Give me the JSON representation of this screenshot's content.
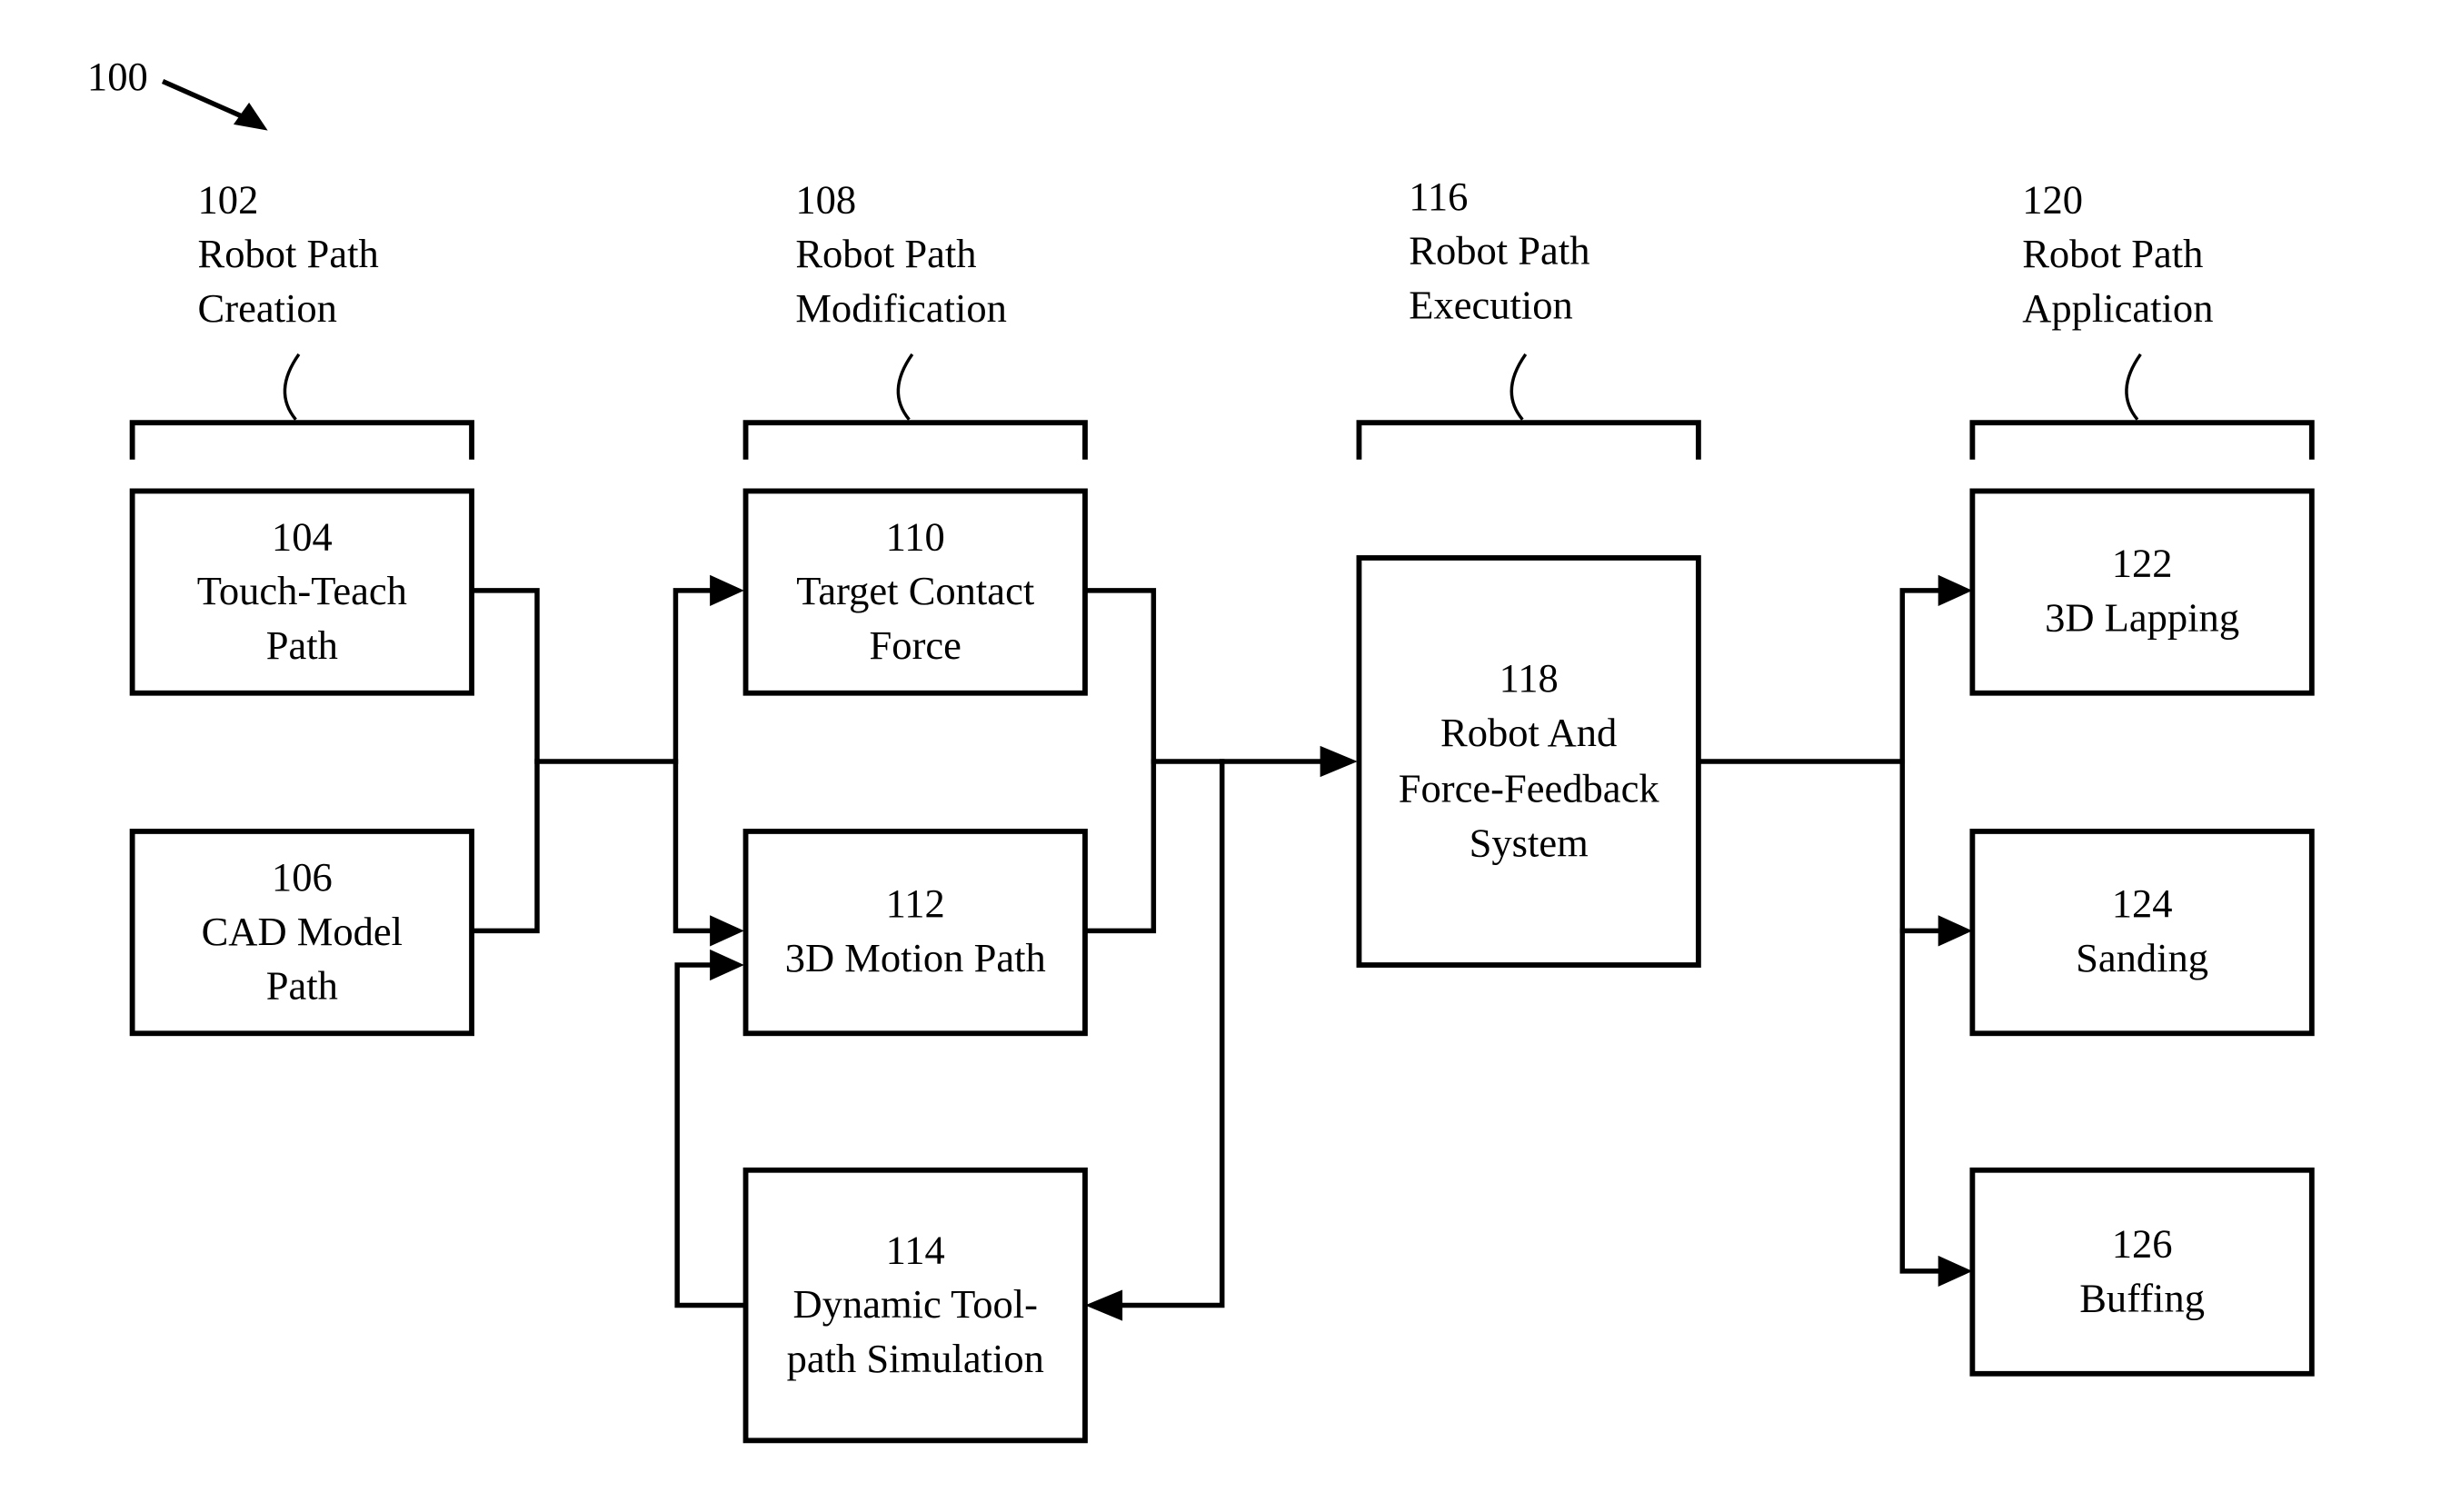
{
  "figure": {
    "reference": "100"
  },
  "groups": [
    {
      "ref": "102",
      "line1": "Robot Path",
      "line2": "Creation"
    },
    {
      "ref": "108",
      "line1": "Robot Path",
      "line2": "Modification"
    },
    {
      "ref": "116",
      "line1": "Robot Path",
      "line2": "Execution"
    },
    {
      "ref": "120",
      "line1": "Robot Path",
      "line2": "Application"
    }
  ],
  "boxes": {
    "b104": {
      "ref": "104",
      "lines": [
        "Touch-Teach",
        "Path"
      ]
    },
    "b106": {
      "ref": "106",
      "lines": [
        "CAD Model",
        "Path"
      ]
    },
    "b110": {
      "ref": "110",
      "lines": [
        "Target Contact",
        "Force"
      ]
    },
    "b112": {
      "ref": "112",
      "lines": [
        "3D Motion Path"
      ]
    },
    "b114": {
      "ref": "114",
      "lines": [
        "Dynamic Tool-",
        "path Simulation"
      ]
    },
    "b118": {
      "ref": "118",
      "lines": [
        "Robot And",
        "Force-Feedback",
        "System"
      ]
    },
    "b122": {
      "ref": "122",
      "lines": [
        "3D Lapping"
      ]
    },
    "b124": {
      "ref": "124",
      "lines": [
        "Sanding"
      ]
    },
    "b126": {
      "ref": "126",
      "lines": [
        "Buffing"
      ]
    }
  },
  "connections": [
    {
      "from": "104",
      "to": "110"
    },
    {
      "from": "104",
      "to": "112"
    },
    {
      "from": "106",
      "to": "110"
    },
    {
      "from": "106",
      "to": "112"
    },
    {
      "from": "110",
      "to": "118"
    },
    {
      "from": "112",
      "to": "118"
    },
    {
      "from": "110",
      "to": "114"
    },
    {
      "from": "112",
      "to": "114"
    },
    {
      "from": "114",
      "to": "112"
    },
    {
      "from": "118",
      "to": "122"
    },
    {
      "from": "118",
      "to": "124"
    },
    {
      "from": "118",
      "to": "126"
    }
  ]
}
